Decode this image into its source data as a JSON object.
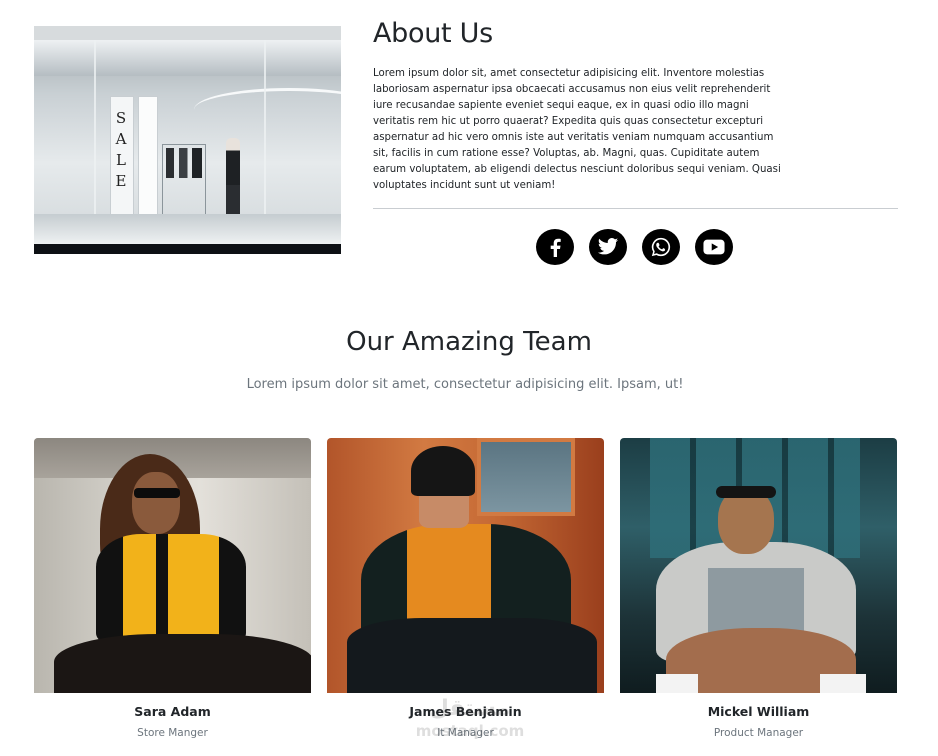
{
  "about": {
    "title": "About Us",
    "text": "Lorem ipsum dolor sit, amet consectetur adipisicing elit. Inventore molestias laboriosam aspernatur ipsa obcaecati accusamus non eius velit reprehenderit iure recusandae sapiente eveniet sequi eaque, ex in quasi odio illo magni veritatis rem hic ut porro quaerat? Expedita quis quas consectetur excepturi aspernatur ad hic vero omnis iste aut veritatis veniam numquam accusantium sit, facilis in cum ratione esse? Voluptas, ab. Magni, quas. Cupiditate autem earum voluptatem, ab eligendi delectus nesciunt doloribus sequi veniam. Quasi voluptates incidunt sunt ut veniam!",
    "image_sign": "SALE",
    "socials": [
      {
        "icon": "facebook-icon"
      },
      {
        "icon": "twitter-icon"
      },
      {
        "icon": "whatsapp-icon"
      },
      {
        "icon": "youtube-icon"
      }
    ]
  },
  "team": {
    "title": "Our Amazing Team",
    "subtitle": "Lorem ipsum dolor sit amet, consectetur adipisicing elit. Ipsam, ut!",
    "members": [
      {
        "name": "Sara Adam",
        "role": "Store Manger"
      },
      {
        "name": "James Benjamin",
        "role": "It Manager"
      },
      {
        "name": "Mickel William",
        "role": "Product Manager"
      }
    ]
  },
  "watermark": {
    "line1": "مستقل",
    "line2": "mostaql.com"
  },
  "colors": {
    "social_bg": "#000000",
    "text": "#212529",
    "muted": "#6c757d",
    "divider": "#c9cdd1"
  }
}
